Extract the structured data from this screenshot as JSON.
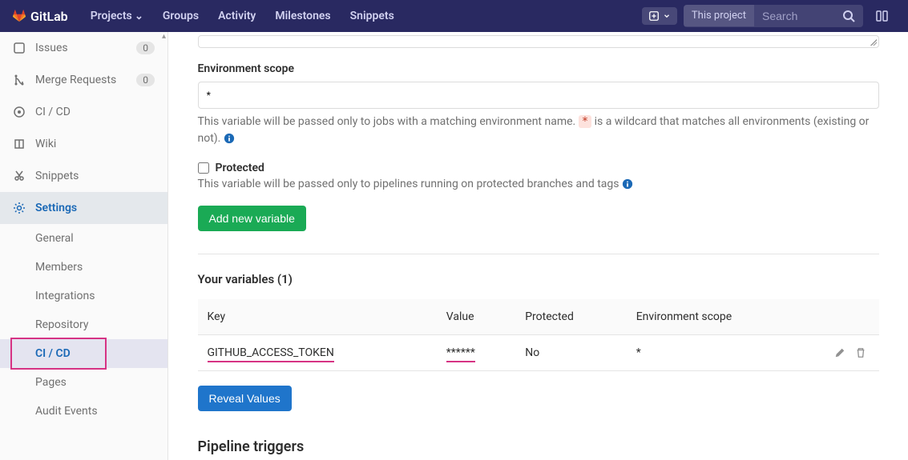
{
  "navbar": {
    "brand": "GitLab",
    "links": [
      "Projects",
      "Groups",
      "Activity",
      "Milestones",
      "Snippets"
    ],
    "search_scope": "This project",
    "search_placeholder": "Search"
  },
  "sidebar": {
    "items": [
      {
        "label": "Issues",
        "badge": "0"
      },
      {
        "label": "Merge Requests",
        "badge": "0"
      },
      {
        "label": "CI / CD"
      },
      {
        "label": "Wiki"
      },
      {
        "label": "Snippets"
      },
      {
        "label": "Settings"
      }
    ],
    "settings_sub": [
      "General",
      "Members",
      "Integrations",
      "Repository",
      "CI / CD",
      "Pages",
      "Audit Events"
    ]
  },
  "main": {
    "env_scope_label": "Environment scope",
    "env_scope_value": "*",
    "env_scope_help_pre": "This variable will be passed only to jobs with a matching environment name. ",
    "env_scope_wildcard": "*",
    "env_scope_help_post": " is a wildcard that matches all environments (existing or not). ",
    "protected_label": "Protected",
    "protected_help": "This variable will be passed only to pipelines running on protected branches and tags ",
    "add_var_btn": "Add new variable",
    "vars_title": "Your variables (1)",
    "table": {
      "headers": [
        "Key",
        "Value",
        "Protected",
        "Environment scope"
      ],
      "row": {
        "key": "GITHUB_ACCESS_TOKEN",
        "value": "******",
        "protected": "No",
        "scope": "*"
      }
    },
    "reveal_btn": "Reveal Values",
    "pipeline_triggers_title": "Pipeline triggers"
  }
}
